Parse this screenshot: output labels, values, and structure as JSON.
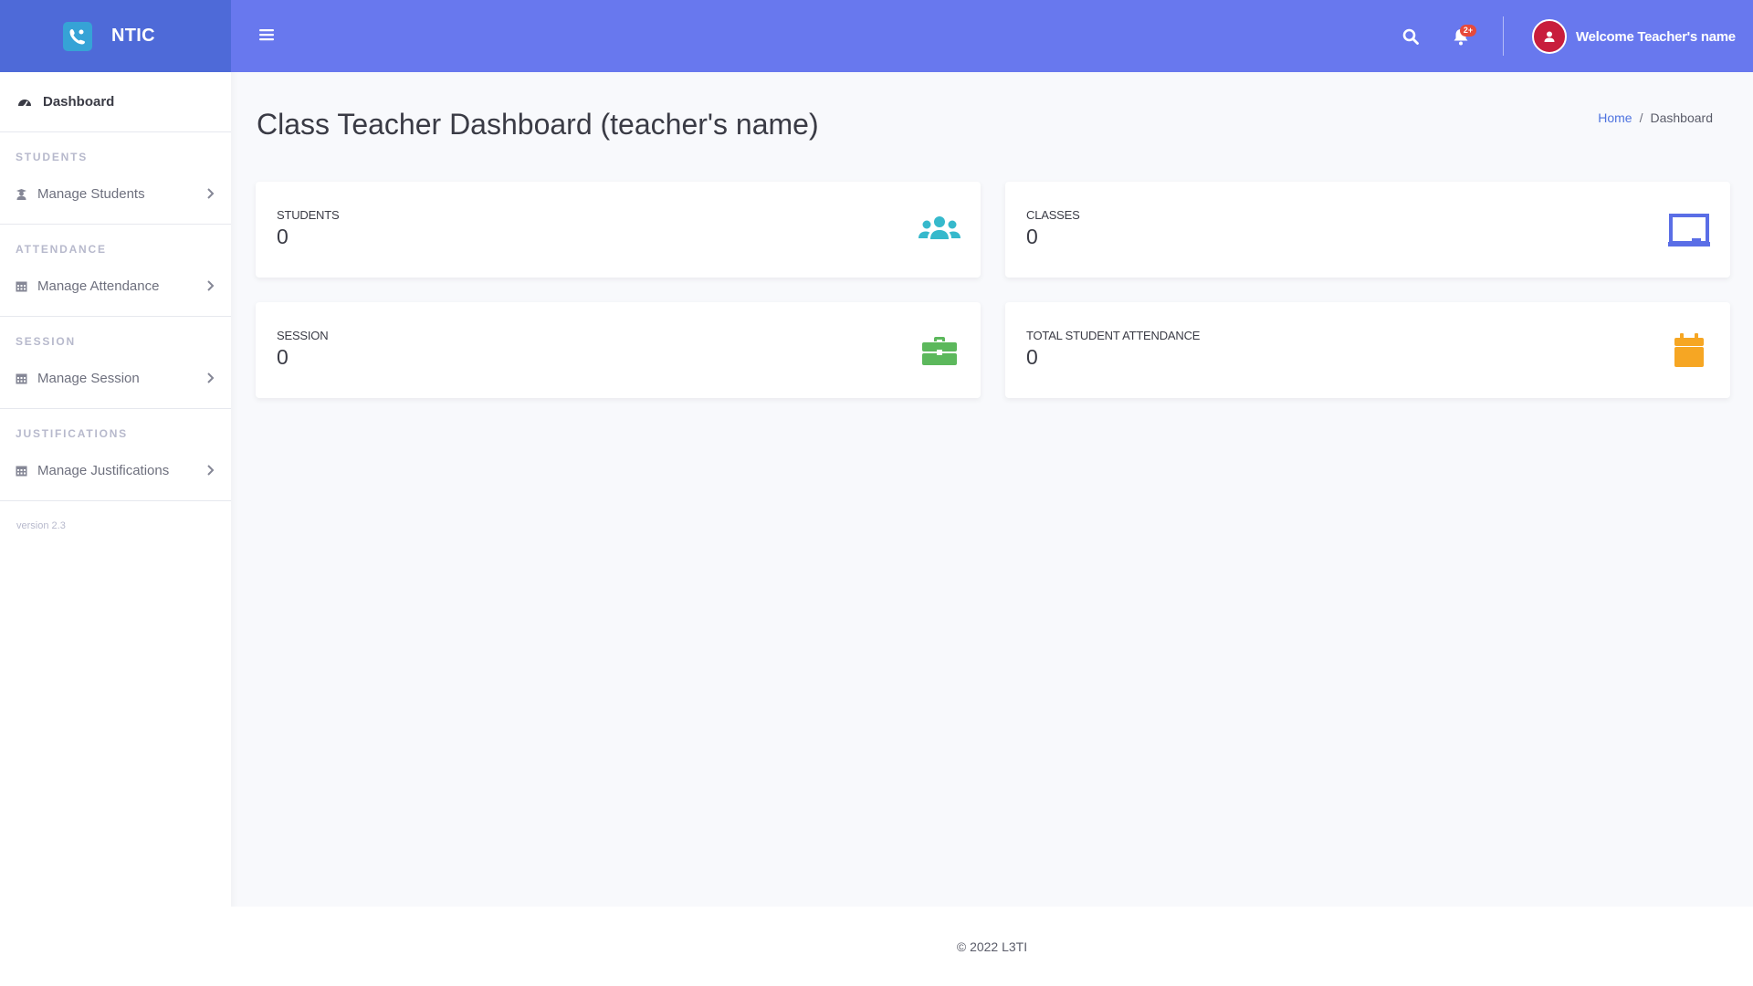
{
  "brand": {
    "name": "NTIC",
    "logo_icon": "phone-user-icon"
  },
  "sidebar": {
    "dashboard_label": "Dashboard",
    "sections": [
      {
        "heading": "STUDENTS",
        "item": "Manage Students"
      },
      {
        "heading": "ATTENDANCE",
        "item": "Manage Attendance"
      },
      {
        "heading": "SESSION",
        "item": "Manage Session"
      },
      {
        "heading": "JUSTIFICATIONS",
        "item": "Manage Justifications"
      }
    ],
    "version": "version 2.3"
  },
  "topbar": {
    "notification_badge": "2+",
    "welcome": "Welcome Teacher's name"
  },
  "page": {
    "title": "Class Teacher Dashboard (teacher's name)",
    "breadcrumb": {
      "home": "Home",
      "separator": "/",
      "current": "Dashboard"
    }
  },
  "cards": [
    {
      "label": "STUDENTS",
      "value": "0",
      "icon": "users-icon",
      "color": "#36b9cc"
    },
    {
      "label": "CLASSES",
      "value": "0",
      "icon": "chalkboard-icon",
      "color": "#5a6ee6"
    },
    {
      "label": "SESSION",
      "value": "0",
      "icon": "briefcase-icon",
      "color": "#5cb85c"
    },
    {
      "label": "TOTAL STUDENT ATTENDANCE",
      "value": "0",
      "icon": "calendar-icon",
      "color": "#f6a623"
    }
  ],
  "footer": {
    "text": "© 2022 L3TI"
  },
  "colors": {
    "primary": "#6878ee",
    "brand_bg": "#4e6ad8",
    "danger": "#e74a3b"
  }
}
